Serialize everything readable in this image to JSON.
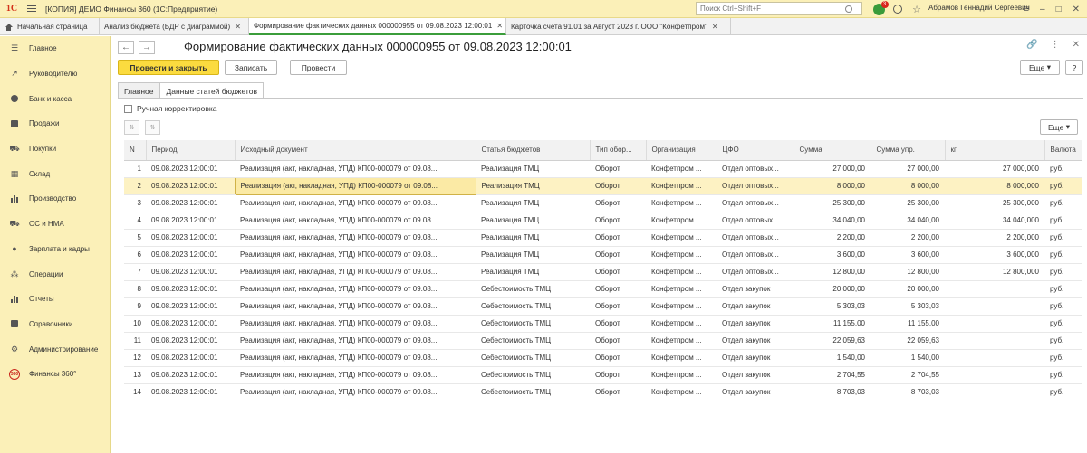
{
  "titlebar": {
    "logo": "1С",
    "title": "[КОПИЯ] ДЕМО Финансы 360  (1С:Предприятие)",
    "search_placeholder": "Поиск Ctrl+Shift+F",
    "notif_count": "3",
    "user": "Абрамов Геннадий Сергеевич"
  },
  "open_tabs": [
    {
      "label": "Начальная страница"
    },
    {
      "label": "Анализ бюджета (БДР с диаграммой)"
    },
    {
      "label": "Формирование фактических данных 000000955 от 09.08.2023 12:00:01"
    },
    {
      "label": "Карточка счета 91.01 за Август 2023 г. ООО \"Конфетпром\""
    }
  ],
  "sidebar": {
    "items": [
      {
        "label": "Главное",
        "icon": "menu-icon"
      },
      {
        "label": "Руководителю",
        "icon": "trend-icon"
      },
      {
        "label": "Банк и касса",
        "icon": "coin-icon"
      },
      {
        "label": "Продажи",
        "icon": "bag-icon"
      },
      {
        "label": "Покупки",
        "icon": "cart-icon"
      },
      {
        "label": "Склад",
        "icon": "warehouse-icon"
      },
      {
        "label": "Производство",
        "icon": "factory-icon"
      },
      {
        "label": "ОС и НМА",
        "icon": "truck-icon"
      },
      {
        "label": "Зарплата и кадры",
        "icon": "person-icon"
      },
      {
        "label": "Операции",
        "icon": "operations-icon"
      },
      {
        "label": "Отчеты",
        "icon": "chart-icon"
      },
      {
        "label": "Справочники",
        "icon": "book-icon"
      },
      {
        "label": "Администрирование",
        "icon": "gear-icon"
      },
      {
        "label": "Финансы 360°",
        "icon": "fin360-icon"
      }
    ],
    "fin360_logo": "360"
  },
  "document": {
    "title": "Формирование фактических данных 000000955 от 09.08.2023 12:00:01",
    "buttons": {
      "post_close": "Провести и закрыть",
      "save": "Записать",
      "post": "Провести",
      "more": "Еще",
      "help": "?"
    },
    "tabs": [
      "Главное",
      "Данные статей бюджетов"
    ],
    "manual_correction": "Ручная корректировка",
    "table_more": "Еще"
  },
  "table": {
    "columns": [
      "N",
      "Период",
      "Исходный документ",
      "Статья бюджетов",
      "Тип обор...",
      "Организация",
      "ЦФО",
      "Сумма",
      "Сумма упр.",
      "кг",
      "Валюта"
    ],
    "rows": [
      [
        "1",
        "09.08.2023 12:00:01",
        "Реализация (акт, накладная, УПД) КП00-000079 от 09.08...",
        "Реализация ТМЦ",
        "Оборот",
        "Конфетпром ...",
        "Отдел оптовых...",
        "27 000,00",
        "27 000,00",
        "27 000,000",
        "руб."
      ],
      [
        "2",
        "09.08.2023 12:00:01",
        "Реализация (акт, накладная, УПД) КП00-000079 от 09.08...",
        "Реализация ТМЦ",
        "Оборот",
        "Конфетпром ...",
        "Отдел оптовых...",
        "8 000,00",
        "8 000,00",
        "8 000,000",
        "руб."
      ],
      [
        "3",
        "09.08.2023 12:00:01",
        "Реализация (акт, накладная, УПД) КП00-000079 от 09.08...",
        "Реализация ТМЦ",
        "Оборот",
        "Конфетпром ...",
        "Отдел оптовых...",
        "25 300,00",
        "25 300,00",
        "25 300,000",
        "руб."
      ],
      [
        "4",
        "09.08.2023 12:00:01",
        "Реализация (акт, накладная, УПД) КП00-000079 от 09.08...",
        "Реализация ТМЦ",
        "Оборот",
        "Конфетпром ...",
        "Отдел оптовых...",
        "34 040,00",
        "34 040,00",
        "34 040,000",
        "руб."
      ],
      [
        "5",
        "09.08.2023 12:00:01",
        "Реализация (акт, накладная, УПД) КП00-000079 от 09.08...",
        "Реализация ТМЦ",
        "Оборот",
        "Конфетпром ...",
        "Отдел оптовых...",
        "2 200,00",
        "2 200,00",
        "2 200,000",
        "руб."
      ],
      [
        "6",
        "09.08.2023 12:00:01",
        "Реализация (акт, накладная, УПД) КП00-000079 от 09.08...",
        "Реализация ТМЦ",
        "Оборот",
        "Конфетпром ...",
        "Отдел оптовых...",
        "3 600,00",
        "3 600,00",
        "3 600,000",
        "руб."
      ],
      [
        "7",
        "09.08.2023 12:00:01",
        "Реализация (акт, накладная, УПД) КП00-000079 от 09.08...",
        "Реализация ТМЦ",
        "Оборот",
        "Конфетпром ...",
        "Отдел оптовых...",
        "12 800,00",
        "12 800,00",
        "12 800,000",
        "руб."
      ],
      [
        "8",
        "09.08.2023 12:00:01",
        "Реализация (акт, накладная, УПД) КП00-000079 от 09.08...",
        "Себестоимость ТМЦ",
        "Оборот",
        "Конфетпром ...",
        "Отдел закупок",
        "20 000,00",
        "20 000,00",
        "",
        "руб."
      ],
      [
        "9",
        "09.08.2023 12:00:01",
        "Реализация (акт, накладная, УПД) КП00-000079 от 09.08...",
        "Себестоимость ТМЦ",
        "Оборот",
        "Конфетпром ...",
        "Отдел закупок",
        "5 303,03",
        "5 303,03",
        "",
        "руб."
      ],
      [
        "10",
        "09.08.2023 12:00:01",
        "Реализация (акт, накладная, УПД) КП00-000079 от 09.08...",
        "Себестоимость ТМЦ",
        "Оборот",
        "Конфетпром ...",
        "Отдел закупок",
        "11 155,00",
        "11 155,00",
        "",
        "руб."
      ],
      [
        "11",
        "09.08.2023 12:00:01",
        "Реализация (акт, накладная, УПД) КП00-000079 от 09.08...",
        "Себестоимость ТМЦ",
        "Оборот",
        "Конфетпром ...",
        "Отдел закупок",
        "22 059,63",
        "22 059,63",
        "",
        "руб."
      ],
      [
        "12",
        "09.08.2023 12:00:01",
        "Реализация (акт, накладная, УПД) КП00-000079 от 09.08...",
        "Себестоимость ТМЦ",
        "Оборот",
        "Конфетпром ...",
        "Отдел закупок",
        "1 540,00",
        "1 540,00",
        "",
        "руб."
      ],
      [
        "13",
        "09.08.2023 12:00:01",
        "Реализация (акт, накладная, УПД) КП00-000079 от 09.08...",
        "Себестоимость ТМЦ",
        "Оборот",
        "Конфетпром ...",
        "Отдел закупок",
        "2 704,55",
        "2 704,55",
        "",
        "руб."
      ],
      [
        "14",
        "09.08.2023 12:00:01",
        "Реализация (акт, накладная, УПД) КП00-000079 от 09.08...",
        "Себестоимость ТМЦ",
        "Оборот",
        "Конфетпром ...",
        "Отдел закупок",
        "8 703,03",
        "8 703,03",
        "",
        "руб."
      ]
    ],
    "selected_row": 2
  },
  "colors": {
    "accent_yellow": "#fbdb3f",
    "sidebar_bg": "#fbf0b8",
    "active_tab_line": "#3b9d3b",
    "selected_row": "#fdf2c3"
  }
}
